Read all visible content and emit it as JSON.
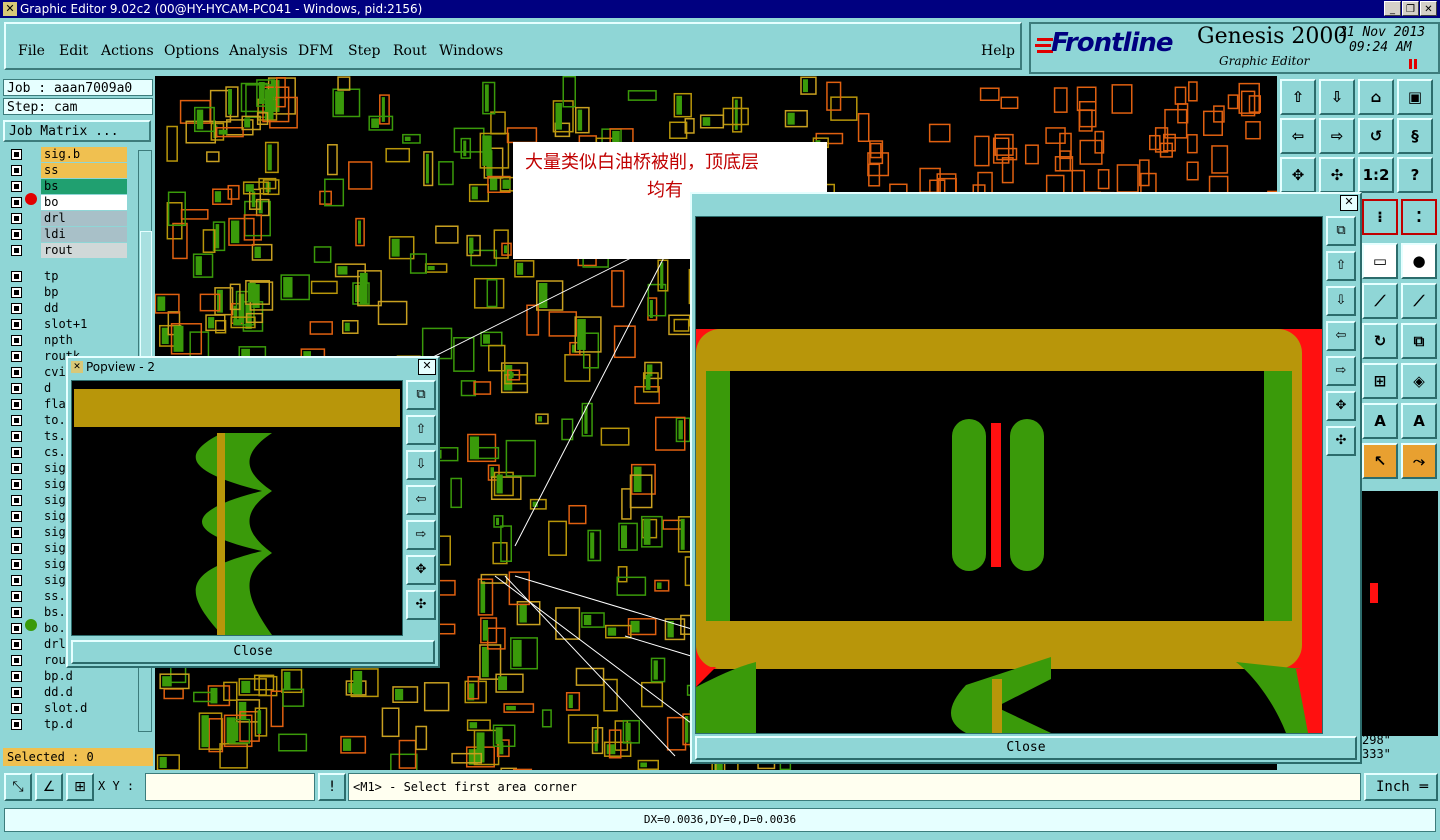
{
  "window": {
    "title": "Graphic Editor 9.02c2 (00@HY-HYCAM-PC041 - Windows, pid:2156)",
    "buttons": [
      "_",
      "❐",
      "✕"
    ]
  },
  "menu": {
    "items": [
      "File",
      "Edit",
      "Actions",
      "Options",
      "Analysis",
      "DFM",
      "Step",
      "Rout",
      "Windows"
    ],
    "help": "Help"
  },
  "brand": {
    "logo": "Frontline",
    "product": "Genesis 2000",
    "subtitle": "Graphic Editor",
    "date": "21 Nov 2013",
    "time": "09:24 AM"
  },
  "left_panel": {
    "job": "Job : aaan7009a0",
    "step": "Step: cam",
    "job_matrix": "Job Matrix ...",
    "selected": "Selected : 0",
    "layers": [
      {
        "name": "sig.b",
        "color": "#f0c050"
      },
      {
        "name": "ss",
        "color": "#f0c050"
      },
      {
        "name": "bs",
        "color": "#20a070"
      },
      {
        "name": "bo",
        "color": "#ffffff"
      },
      {
        "name": "drl",
        "color": "#a8c0c8"
      },
      {
        "name": "ldi",
        "color": "#a8c0c8"
      },
      {
        "name": "rout",
        "color": "#d0d8d8"
      },
      {
        "name": "tp",
        "color": "#8fd6d6"
      },
      {
        "name": "bp",
        "color": "#8fd6d6"
      },
      {
        "name": "dd",
        "color": "#8fd6d6"
      },
      {
        "name": "slot+1",
        "color": "#8fd6d6"
      },
      {
        "name": "npth",
        "color": "#8fd6d6"
      },
      {
        "name": "routk",
        "color": "#8fd6d6"
      },
      {
        "name": "cvi",
        "color": "#8fd6d6"
      },
      {
        "name": "d",
        "color": "#8fd6d6"
      },
      {
        "name": "fla",
        "color": "#8fd6d6"
      },
      {
        "name": "to.",
        "color": "#8fd6d6"
      },
      {
        "name": "ts.",
        "color": "#8fd6d6"
      },
      {
        "name": "cs.",
        "color": "#8fd6d6"
      },
      {
        "name": "sig",
        "color": "#8fd6d6"
      },
      {
        "name": "sig",
        "color": "#8fd6d6"
      },
      {
        "name": "sig",
        "color": "#8fd6d6"
      },
      {
        "name": "sig",
        "color": "#8fd6d6"
      },
      {
        "name": "sig",
        "color": "#8fd6d6"
      },
      {
        "name": "sig",
        "color": "#8fd6d6"
      },
      {
        "name": "sig",
        "color": "#8fd6d6"
      },
      {
        "name": "sig",
        "color": "#8fd6d6"
      },
      {
        "name": "ss.",
        "color": "#8fd6d6"
      },
      {
        "name": "bs.",
        "color": "#8fd6d6"
      },
      {
        "name": "bo.",
        "color": "#8fd6d6"
      },
      {
        "name": "drl",
        "color": "#8fd6d6"
      },
      {
        "name": "rou",
        "color": "#8fd6d6"
      },
      {
        "name": "bp.d",
        "color": "#8fd6d6"
      },
      {
        "name": "dd.d",
        "color": "#8fd6d6"
      },
      {
        "name": "slot.d",
        "color": "#8fd6d6"
      },
      {
        "name": "tp.d",
        "color": "#8fd6d6"
      }
    ]
  },
  "annotation": {
    "line1": "大量类似白油桥被削，顶底层",
    "line2": "均有"
  },
  "popview_small": {
    "title": "Popview - 2",
    "close": "Close"
  },
  "popview_large": {
    "close": "Close"
  },
  "right_tools": {
    "buttons": [
      "1:2",
      "?"
    ],
    "side_values": [
      "298\"",
      "333\""
    ]
  },
  "status": {
    "xy_label": "X Y :",
    "xy_value": "",
    "prompt": "<M1> - Select first area corner",
    "unit": "Inch",
    "coords": "DX=0.0036,DY=0,D=0.0036"
  },
  "colors": {
    "panel": "#8fd6d6",
    "title_bar": "#000080",
    "board_top": "#b8960a",
    "board_green": "#3a9a0a",
    "board_red": "#ff1010"
  }
}
